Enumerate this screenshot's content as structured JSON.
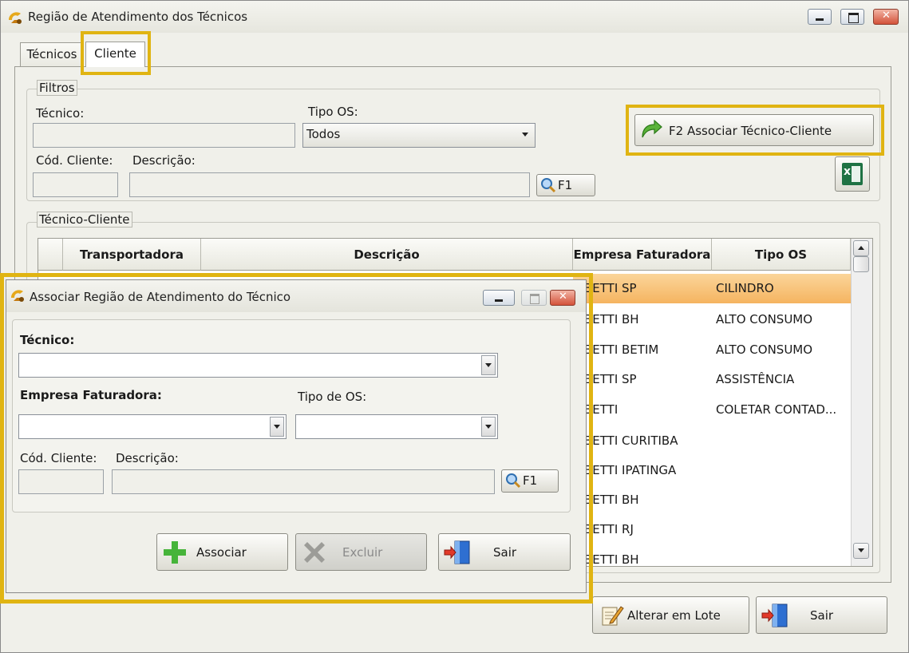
{
  "main": {
    "title": "Região de Atendimento dos Técnicos",
    "tabs": [
      "Técnicos",
      "Cliente"
    ],
    "filters": {
      "group_label": "Filtros",
      "tecnico_label": "Técnico:",
      "tipo_os_label": "Tipo OS:",
      "tipo_os_value": "Todos",
      "cod_cliente_label": "Cód. Cliente:",
      "descricao_label": "Descrição:",
      "search_button": "F1",
      "associate_button": "F2 Associar Técnico-Cliente"
    },
    "grid": {
      "group_label": "Técnico-Cliente",
      "columns": [
        "Transportadora",
        "Descrição",
        "Empresa Faturadora",
        "Tipo OS"
      ],
      "rows": [
        {
          "empresa": "BETTI SP",
          "tipo": "CILINDRO"
        },
        {
          "empresa": "BETTI BH",
          "tipo": "ALTO CONSUMO"
        },
        {
          "empresa": "BETTI BETIM",
          "tipo": "ALTO CONSUMO"
        },
        {
          "empresa": "BETTI SP",
          "tipo": "ASSISTÊNCIA"
        },
        {
          "empresa": "BETTI",
          "tipo": "COLETAR CONTAD..."
        },
        {
          "empresa": "BETTI CURITIBA",
          "tipo": ""
        },
        {
          "empresa": "BETTI IPATINGA",
          "tipo": ""
        },
        {
          "empresa": "BETTI BH",
          "tipo": ""
        },
        {
          "empresa": "BETTI RJ",
          "tipo": ""
        },
        {
          "empresa": "BETTI BH",
          "tipo": ""
        }
      ]
    },
    "alter_button": "Alterar em Lote",
    "exit_button": "Sair"
  },
  "dialog": {
    "title": "Associar Região de Atendimento do Técnico",
    "tecnico_label": "Técnico:",
    "empresa_label": "Empresa Faturadora:",
    "tipo_os_label": "Tipo de OS:",
    "cod_cliente_label": "Cód. Cliente:",
    "descricao_label": "Descrição:",
    "search_button": "F1",
    "associar_button": "Associar",
    "excluir_button": "Excluir",
    "sair_button": "Sair"
  },
  "colors": {
    "highlight": "#e0b412",
    "selected_row": "#f7c068"
  }
}
